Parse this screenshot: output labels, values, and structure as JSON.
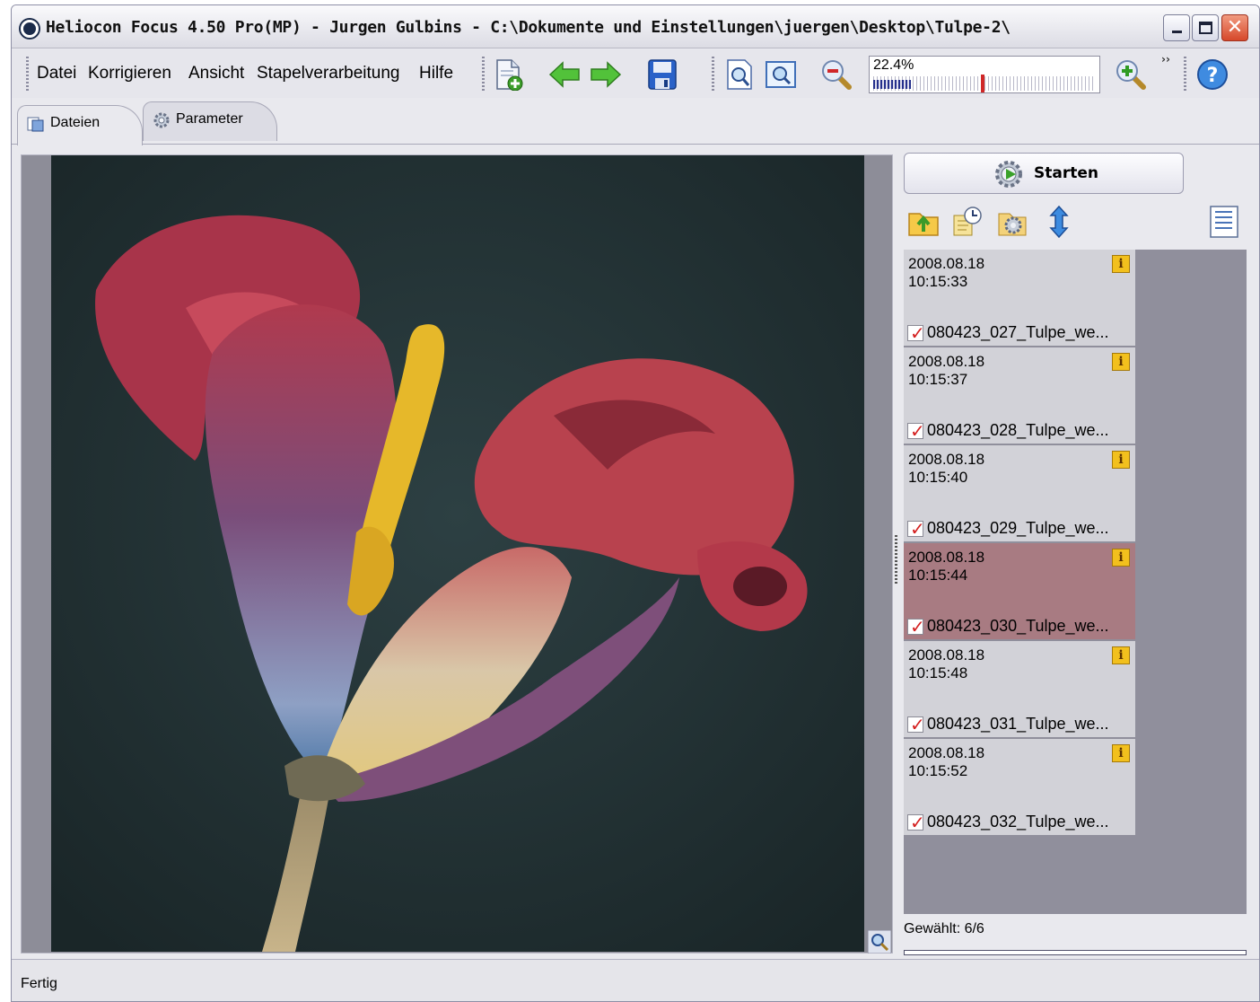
{
  "window": {
    "title": "Heliocon Focus 4.50 Pro(MP) - Jurgen Gulbins - C:\\Dokumente und Einstellungen\\juergen\\Desktop\\Tulpe-2\\",
    "controls": {
      "minimize": "minimize",
      "maximize": "maximize",
      "close": "✕"
    }
  },
  "menu": [
    "Datei",
    "Korrigieren",
    "Ansicht",
    "Stapelverarbeitung",
    "Hilfe"
  ],
  "toolbar": {
    "icons": [
      "add-image-icon",
      "arrow-left-icon",
      "arrow-right-icon",
      "save-icon",
      "zoom-page-icon",
      "zoom-fit-icon",
      "zoom-out-icon",
      "zoom-in-icon",
      "help-icon"
    ],
    "zoom_value": "22.4%",
    "zoom_fraction": 0.224,
    "overflow": "››"
  },
  "tabs": [
    {
      "label": "Dateien",
      "active": true
    },
    {
      "label": "Parameter",
      "active": false
    }
  ],
  "panel": {
    "start_label": "Starten",
    "selected_text": "Gewählt: 6/6",
    "files": [
      {
        "date": "2008.08.18",
        "time": "10:15:33",
        "name": "080423_027_Tulpe_we...",
        "checked": true,
        "selected": false
      },
      {
        "date": "2008.08.18",
        "time": "10:15:37",
        "name": "080423_028_Tulpe_we...",
        "checked": true,
        "selected": false
      },
      {
        "date": "2008.08.18",
        "time": "10:15:40",
        "name": "080423_029_Tulpe_we...",
        "checked": true,
        "selected": false
      },
      {
        "date": "2008.08.18",
        "time": "10:15:44",
        "name": "080423_030_Tulpe_we...",
        "checked": true,
        "selected": true
      },
      {
        "date": "2008.08.18",
        "time": "10:15:48",
        "name": "080423_031_Tulpe_we...",
        "checked": true,
        "selected": false
      },
      {
        "date": "2008.08.18",
        "time": "10:15:52",
        "name": "080423_032_Tulpe_we...",
        "checked": true,
        "selected": false
      }
    ],
    "info_glyph": "i",
    "check_glyph": "✓"
  },
  "status": {
    "text": "Fertig"
  },
  "colors": {
    "selection": "#a87b82",
    "list_bg": "#908f9c",
    "image_bg": "#1f2e31"
  }
}
